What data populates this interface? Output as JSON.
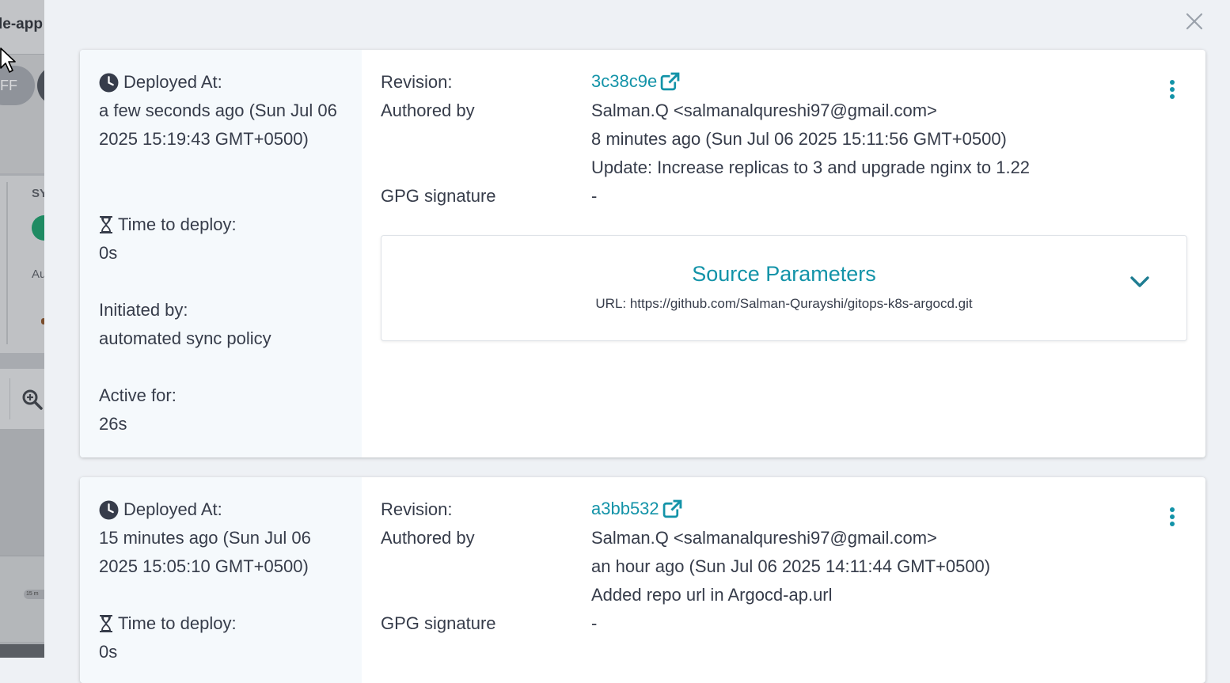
{
  "background_app": {
    "title": "le-app",
    "pill_text": "FF",
    "status_label": "SY",
    "status_sub": "Au",
    "timeline_tick": "15 m"
  },
  "panel": {
    "close_icon": "close-icon"
  },
  "history": [
    {
      "deployed_at_label": "Deployed At:",
      "deployed_at_value": "a few seconds ago (Sun Jul 06 2025 15:19:43 GMT+0500)",
      "time_to_deploy_label": "Time to deploy:",
      "time_to_deploy_value": "0s",
      "initiated_by_label": "Initiated by:",
      "initiated_by_value": "automated sync policy",
      "active_for_label": "Active for:",
      "active_for_value": "26s",
      "revision_label": "Revision:",
      "revision": "3c38c9e",
      "authored_by_label": "Authored by",
      "author": "Salman.Q <salmanalqureshi97@gmail.com>",
      "authored_time": "8 minutes ago (Sun Jul 06 2025 15:11:56 GMT+0500)",
      "commit_message": "Update: Increase replicas to 3 and upgrade nginx to 1.22",
      "gpg_label": "GPG signature",
      "gpg_value": "-",
      "source_parameters": {
        "title": "Source Parameters",
        "url": "URL: https://github.com/Salman-Qurayshi/gitops-k8s-argocd.git"
      }
    },
    {
      "deployed_at_label": "Deployed At:",
      "deployed_at_value": "15 minutes ago (Sun Jul 06 2025 15:05:10 GMT+0500)",
      "time_to_deploy_label": "Time to deploy:",
      "time_to_deploy_value": "0s",
      "revision_label": "Revision:",
      "revision": "a3bb532",
      "authored_by_label": "Authored by",
      "author": "Salman.Q <salmanalqureshi97@gmail.com>",
      "authored_time": "an hour ago (Sun Jul 06 2025 14:11:44 GMT+0500)",
      "commit_message": "Added repo url in Argocd-ap.url",
      "gpg_label": "GPG signature",
      "gpg_value": "-"
    }
  ],
  "colors": {
    "accent": "#1393a8",
    "text": "#363c4a",
    "left_column_bg": "#f5f9fc"
  }
}
